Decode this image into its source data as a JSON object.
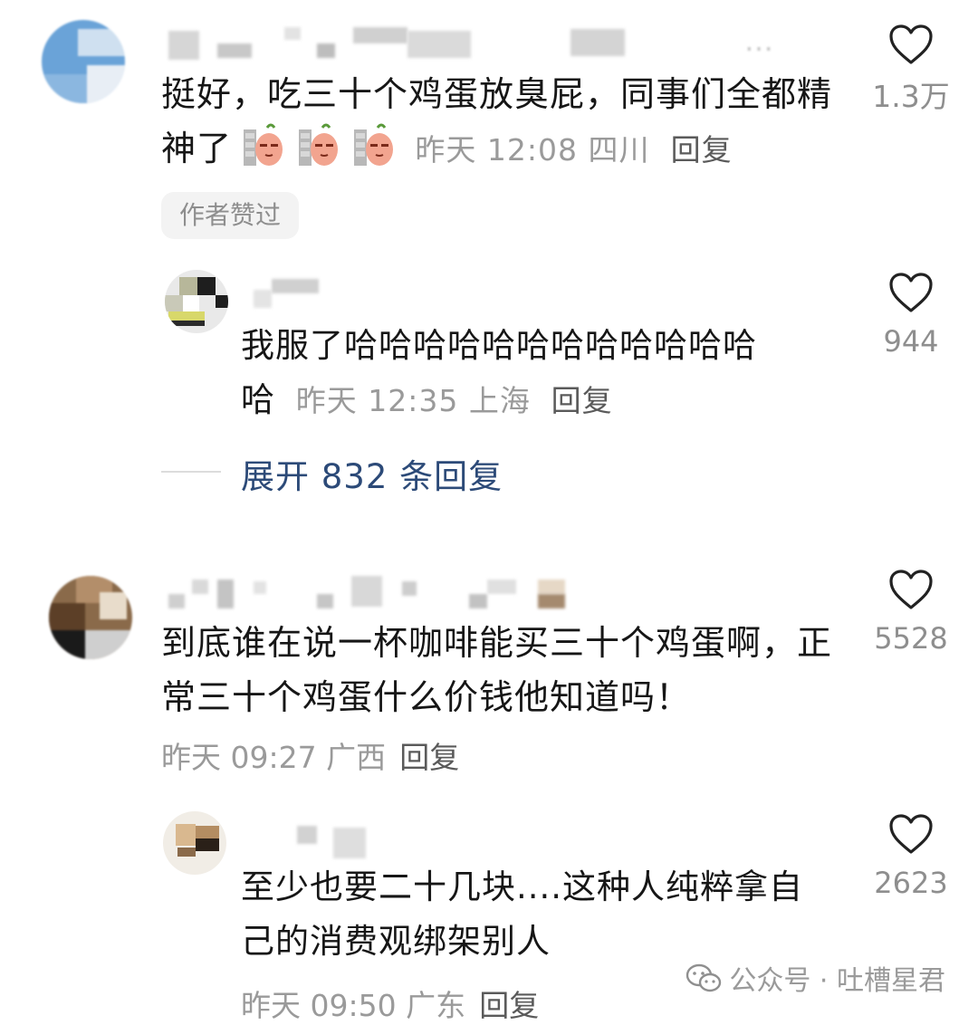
{
  "comments": [
    {
      "text_line1": "挺好，吃三十个鸡蛋放臭屁，同事们全都精",
      "text_line2": "神了",
      "meta": "昨天 12:08 四川",
      "reply_label": "回复",
      "likes": "1.3万",
      "badge": "作者赞过",
      "username_hint": "…",
      "replies": [
        {
          "text_line1": "我服了哈哈哈哈哈哈哈哈哈哈哈哈",
          "text_line2": "哈",
          "meta": "昨天 12:35 上海",
          "reply_label": "回复",
          "likes": "944"
        }
      ],
      "expand_label": "展开 832 条回复"
    },
    {
      "text_line1": "到底谁在说一杯咖啡能买三十个鸡蛋啊，正",
      "text_line2": "常三十个鸡蛋什么价钱他知道吗！",
      "meta": "昨天 09:27 广西",
      "reply_label": "回复",
      "likes": "5528",
      "replies": [
        {
          "text_line1": "至少也要二十几块....这种人纯粹拿自",
          "text_line2": "己的消费观绑架别人",
          "meta": "昨天 09:50 广东",
          "reply_label": "回复",
          "likes": "2623"
        }
      ]
    }
  ],
  "watermark": "公众号 · 吐槽星君",
  "icons": {
    "like": "heart-icon",
    "watermark": "wechat-icon",
    "emoji": "sticker-emoji-icon"
  },
  "colors": {
    "text": "#161616",
    "meta": "#9a9a9a",
    "link": "#2c4a78",
    "badge_bg": "#f3f3f3"
  }
}
